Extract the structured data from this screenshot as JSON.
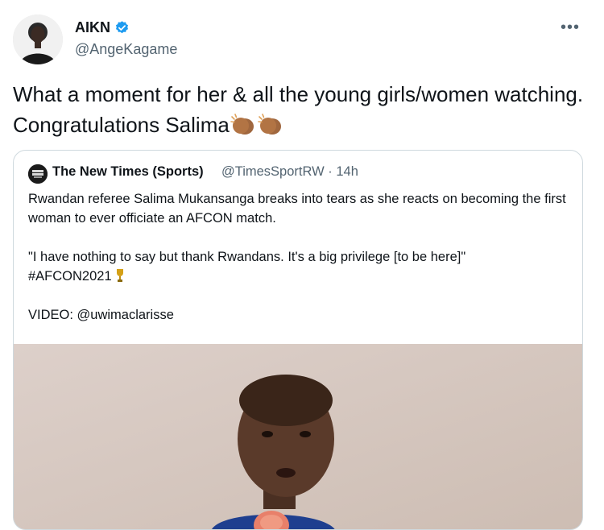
{
  "author": {
    "display_name": "AIKN",
    "handle": "@AngeKagame"
  },
  "tweet": {
    "text": "What a moment for her & all the young girls/women watching. Congratulations Salima"
  },
  "quoted": {
    "name": "The New Times (Sports)",
    "handle_time": "@TimesSportRW · 14h",
    "line1": "Rwandan referee Salima Mukansanga breaks into tears as she reacts on becoming the first woman to ever officiate an AFCON match.",
    "line2": "\"I have nothing to say but thank Rwandans. It's a big privilege [to be here]\"",
    "hashtag": "#AFCON2021",
    "video_credit": "VIDEO: @uwimaclarisse"
  },
  "icons": {
    "verified": "verified-badge-icon",
    "more": "more-options-icon",
    "clap": "clapping-hands-emoji",
    "trophy": "trophy-emoji"
  },
  "colors": {
    "verified_blue": "#1d9bf0",
    "secondary_text": "#536471",
    "border": "#cfd9de"
  }
}
